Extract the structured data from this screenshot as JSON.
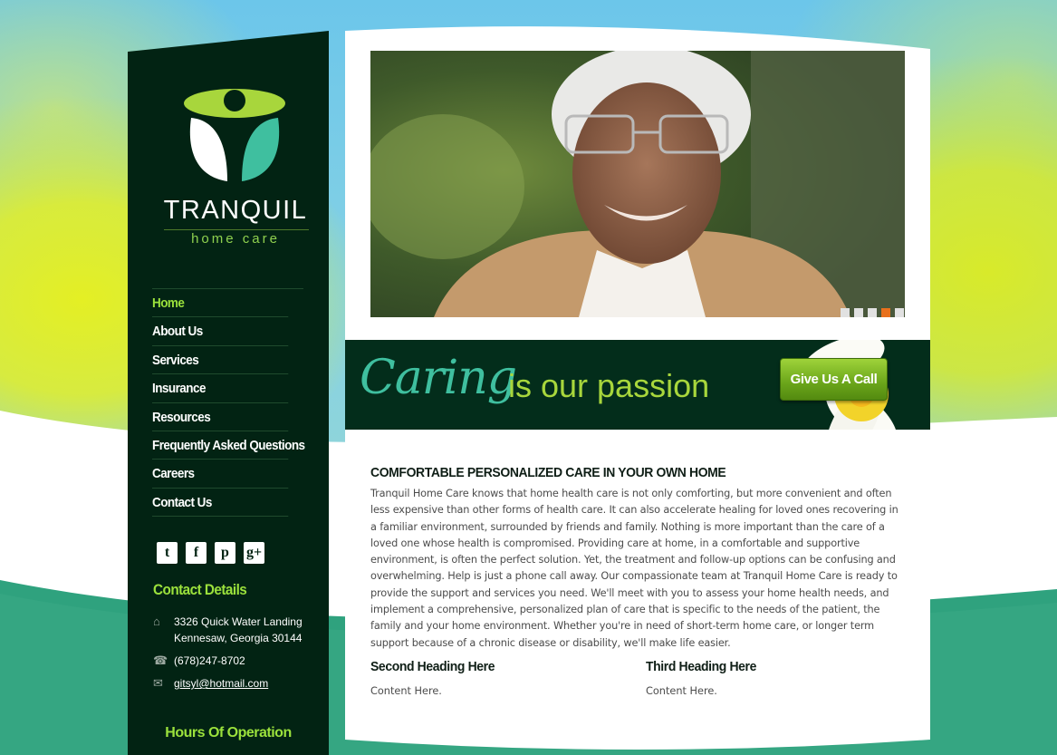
{
  "brand": {
    "name": "TRANQUIL",
    "tagline": "home care"
  },
  "colors": {
    "sidebar_bg": "#022313",
    "accent_green": "#9be13c",
    "teal": "#3fbf9f",
    "orange": "#e8701c"
  },
  "nav": {
    "items": [
      {
        "label": "Home",
        "active": true
      },
      {
        "label": "About Us",
        "active": false
      },
      {
        "label": "Services",
        "active": false
      },
      {
        "label": "Insurance",
        "active": false
      },
      {
        "label": "Resources",
        "active": false
      },
      {
        "label": "Frequently Asked Questions",
        "active": false
      },
      {
        "label": "Careers",
        "active": false
      },
      {
        "label": "Contact Us",
        "active": false
      }
    ]
  },
  "social": {
    "icons": [
      "twitter-icon",
      "facebook-icon",
      "pinterest-icon",
      "google-plus-icon"
    ],
    "glyphs": [
      "t",
      "f",
      "p",
      "g+"
    ]
  },
  "contact": {
    "heading": "Contact Details",
    "address_line1": "3326 Quick Water Landing",
    "address_line2": "Kennesaw, Georgia 30144",
    "phone": "(678)247-8702",
    "email": "gitsyl@hotmail.com"
  },
  "hours": {
    "heading": "Hours Of Operation"
  },
  "slider": {
    "slide_count": 5,
    "active_index": 3
  },
  "banner": {
    "script_word": "Caring",
    "rest": "is our passion",
    "button": "Give Us A Call"
  },
  "main": {
    "heading": "COMFORTABLE PERSONALIZED CARE IN YOUR OWN HOME",
    "body": "Tranquil Home Care knows that home health care is not only comforting, but more convenient and often less expensive than other forms of health care. It can also accelerate healing for loved ones recovering in a familiar environment, surrounded by friends and family. Nothing is more important than the care of a loved one whose health is compromised. Providing care at home, in a comfortable and supportive environment, is often the perfect solution. Yet, the treatment and follow-up options can be confusing and overwhelming. Help is just a phone call away. Our compassionate team at Tranquil Home Care is ready to provide the support and services you need. We'll meet with you to assess your home health needs, and implement a comprehensive, personalized plan of care that is specific to the needs of the patient, the family and your home environment. Whether you're in need of short-term home care, or longer term support because of a chronic disease or disability, we'll make life easier."
  },
  "columns": [
    {
      "heading": "Second Heading Here",
      "body": "Content Here."
    },
    {
      "heading": "Third Heading Here",
      "body": "Content Here."
    }
  ]
}
